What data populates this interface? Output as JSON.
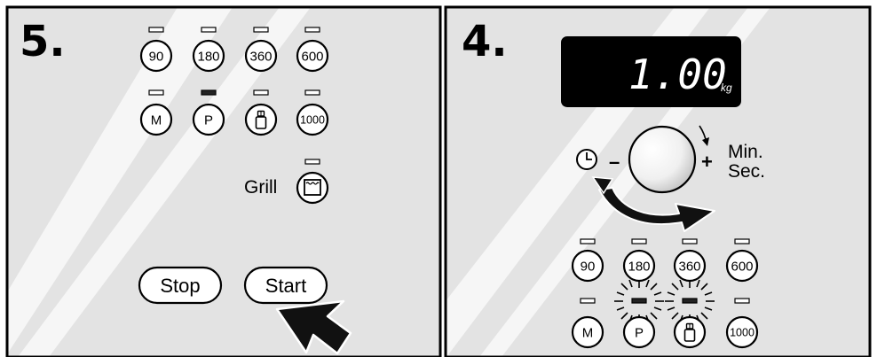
{
  "panels": {
    "left": {
      "step_number": "5."
    },
    "right": {
      "step_number": "4."
    }
  },
  "power_buttons": {
    "b90": "90",
    "b180": "180",
    "b360": "360",
    "b600": "600"
  },
  "mode_buttons": {
    "m": "M",
    "p": "P",
    "b1000": "1000"
  },
  "grill": {
    "label": "Grill"
  },
  "controls": {
    "stop": "Stop",
    "start": "Start"
  },
  "display": {
    "value": "1.00",
    "unit": "kg"
  },
  "dial": {
    "plus": "+",
    "minus": "–",
    "min": "Min.",
    "sec": "Sec."
  }
}
